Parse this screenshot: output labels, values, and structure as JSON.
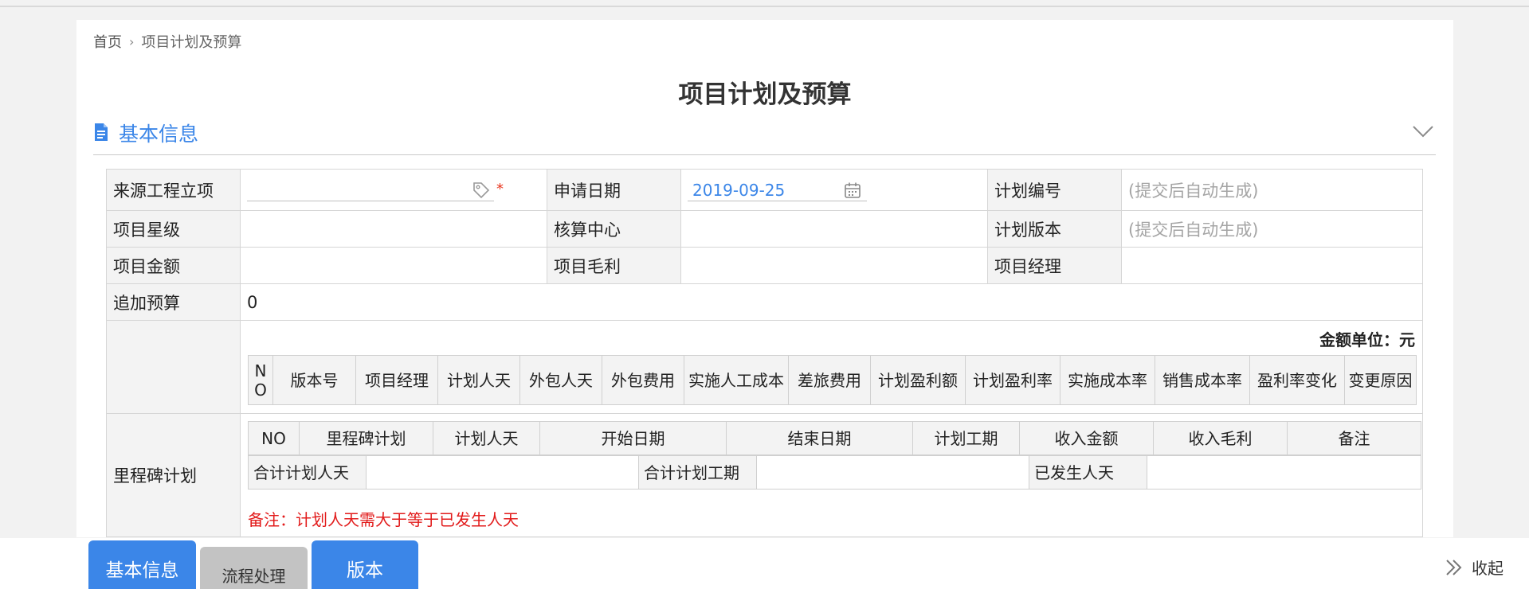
{
  "breadcrumb": {
    "home": "首页",
    "separator": "›",
    "current": "项目计划及预算"
  },
  "page_title": "项目计划及预算",
  "section": {
    "title": "基本信息",
    "icon": "document-icon",
    "toggle_icon": "chevron-down-icon"
  },
  "form": {
    "source_project_label": "来源工程立项",
    "source_project_value": "",
    "apply_date_label": "申请日期",
    "apply_date_value": "2019-09-25",
    "plan_no_label": "计划编号",
    "plan_no_value": "(提交后自动生成)",
    "project_star_label": "项目星级",
    "accounting_center_label": "核算中心",
    "plan_version_label": "计划版本",
    "plan_version_value": "(提交后自动生成)",
    "project_amount_label": "项目金额",
    "project_gross_label": "项目毛利",
    "project_manager_label": "项目经理",
    "extra_budget_label": "追加预算",
    "extra_budget_value": "0",
    "required_mark": "*"
  },
  "version_table": {
    "unit": "金额单位：元",
    "headers": [
      "NO",
      "版本号",
      "项目经理",
      "计划人天",
      "外包人天",
      "外包费用",
      "实施人工成本",
      "差旅费用",
      "计划盈利额",
      "计划盈利率",
      "实施成本率",
      "销售成本率",
      "盈利率变化",
      "变更原因"
    ]
  },
  "milestone": {
    "label": "里程碑计划",
    "headers": [
      "NO",
      "里程碑计划",
      "计划人天",
      "开始日期",
      "结束日期",
      "计划工期",
      "收入金额",
      "收入毛利",
      "备注"
    ],
    "totals": {
      "planned_days_label": "合计计划人天",
      "planned_days_value": "",
      "planned_period_label": "合计计划工期",
      "planned_period_value": "",
      "actual_days_label": "已发生人天",
      "actual_days_value": ""
    },
    "note": "备注：计划人天需大于等于已发生人天"
  },
  "bottom_tabs": [
    "基本信息",
    "流程处理",
    "版本"
  ],
  "collapse_label": "收起",
  "colors": {
    "accent": "#3b86e8",
    "warning": "#e21b1b",
    "label_bg": "#f3f3f3"
  }
}
